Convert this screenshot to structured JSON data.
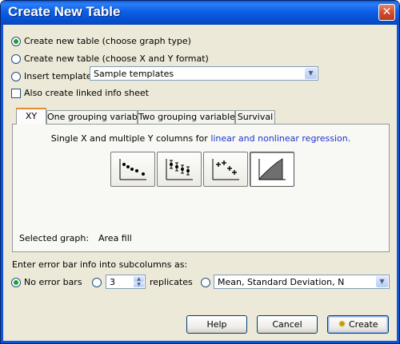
{
  "window": {
    "title": "Create New Table",
    "close_glyph": "✕"
  },
  "options": {
    "choose_graph_type": "Create new table (choose graph type)",
    "choose_xy_format": "Create new table (choose X and Y format)",
    "insert_template": "Insert template",
    "template_selected": "Sample templates",
    "linked_info": "Also create linked info sheet"
  },
  "tabs": [
    {
      "label": "XY"
    },
    {
      "label": "One grouping variable"
    },
    {
      "label": "Two grouping variables"
    },
    {
      "label": "Survival"
    }
  ],
  "panel": {
    "description_prefix": "Single X and multiple Y columns for ",
    "description_link": "linear and nonlinear regression.",
    "graph_icons": [
      "scatter-points-icon",
      "scatter-error-bars-icon",
      "scatter-star-icon",
      "area-fill-icon"
    ],
    "selected_label": "Selected graph:",
    "selected_value": "Area fill"
  },
  "error_bars": {
    "prompt": "Enter error bar info into subcolumns as:",
    "none_label": "No error bars",
    "replicates_value": "3",
    "replicates_label": "replicates",
    "stat_selected": "Mean, Standard Deviation, N"
  },
  "buttons": {
    "help": "Help",
    "cancel": "Cancel",
    "create": "Create"
  },
  "colors": {
    "titlebar": "#0d5ee6",
    "link": "#1d33cf",
    "radio_selected": "#21a121",
    "active_tab_accent": "#e68b2c"
  }
}
